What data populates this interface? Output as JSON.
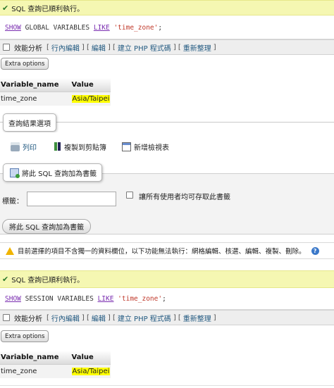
{
  "block1": {
    "success_msg": "SQL 查詢已順利執行。",
    "sql": {
      "kw1": "SHOW",
      "mid": " GLOBAL VARIABLES ",
      "kw2": "LIKE",
      "str": " 'time_zone'",
      "end": ";"
    },
    "opts": {
      "profiling": "效能分析",
      "inline_edit": "行內編輯",
      "edit": "編輯",
      "create_php": "建立 PHP 程式碼",
      "refresh": "重新整理"
    },
    "extra_options": "Extra options",
    "table": {
      "col_name": "Variable_name",
      "col_value": "Value",
      "row_name": "time_zone",
      "row_value": "Asia/Taipei"
    }
  },
  "ops": {
    "legend": "查詢結果選項",
    "print": "列印",
    "copy": "複製到剪貼簿",
    "create_view": "新增檢視表"
  },
  "bookmark": {
    "legend": "將此 SQL 查詢加為書籤",
    "label_field": "標籤：",
    "label_value": "",
    "share_label": "讓所有使用者均可存取此書籤",
    "submit": "將此 SQL 查詢加為書籤"
  },
  "notice": {
    "text": "目前選擇的項目不含獨一的資料欄位，以下功能無法執行：網格編輯、核選、編輯、複製、刪除。"
  },
  "block2": {
    "success_msg": "SQL 查詢已順利執行。",
    "sql": {
      "kw1": "SHOW",
      "mid": " SESSION VARIABLES ",
      "kw2": "LIKE",
      "str": " 'time_zone'",
      "end": ";"
    },
    "opts": {
      "profiling": "效能分析",
      "inline_edit": "行內編輯",
      "edit": "編輯",
      "create_php": "建立 PHP 程式碼",
      "refresh": "重新整理"
    },
    "extra_options": "Extra options",
    "table": {
      "col_name": "Variable_name",
      "col_value": "Value",
      "row_name": "time_zone",
      "row_value": "Asia/Taipei"
    }
  },
  "colors": {
    "success_bg": "#f5f7b2",
    "highlight": "#ffff00",
    "link": "#235a81",
    "keyword": "#7a2db0",
    "string": "#c0392b"
  }
}
